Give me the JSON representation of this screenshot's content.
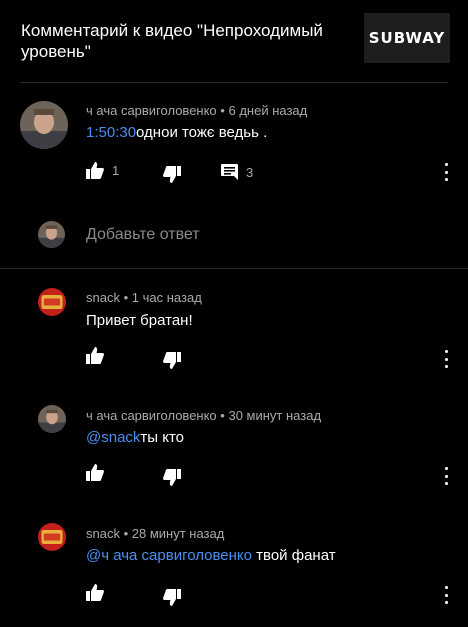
{
  "header": {
    "title": "Комментарий к видео \"Непроходимый уровень\"",
    "brand": "SUBWAY"
  },
  "comment": {
    "author": "ч ача сарвиголовенко",
    "time": "6 дней назад",
    "timestamp_link": "1:50:30",
    "text": "однои тожє ведьь .",
    "likes": "1",
    "replies": "3"
  },
  "reply_box": {
    "placeholder": "Добавьте ответ"
  },
  "replies": [
    {
      "author": "snack",
      "time": "1 час назад",
      "mention": "",
      "text": "Привет братан!"
    },
    {
      "author": "ч ача сарвиголовенко",
      "time": "30 минут назад",
      "mention": "@snack",
      "text": "ты кто"
    },
    {
      "author": "snack",
      "time": "28 минут назад",
      "mention": "@ч ача сарвиголовенко",
      "text": " твой фанат"
    }
  ],
  "separator": "•",
  "colors": {
    "background": "#000000",
    "link": "#4a8ff0",
    "meta": "#aaaaaa"
  },
  "icons": [
    "thumb-up-icon",
    "thumb-down-icon",
    "comment-icon",
    "more-vert-icon"
  ]
}
